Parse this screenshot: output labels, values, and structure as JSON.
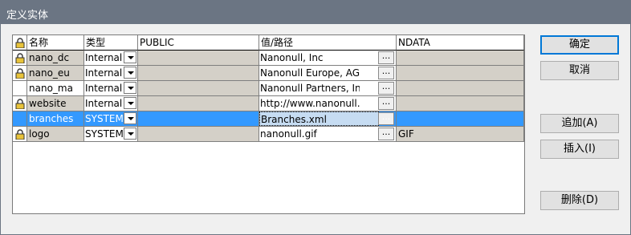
{
  "window": {
    "title": "定义实体"
  },
  "grid": {
    "headers": [
      "名称",
      "类型",
      "PUBLIC",
      "值/路径",
      "NDATA"
    ],
    "rows": [
      {
        "locked": true,
        "name": "nano_dc",
        "type": "Internal",
        "public": "",
        "value": "Nanonull, Inc",
        "ndata": "",
        "selected": false
      },
      {
        "locked": true,
        "name": "nano_eu",
        "type": "Internal",
        "public": "",
        "value": "Nanonull Europe, AG",
        "ndata": "",
        "selected": false
      },
      {
        "locked": false,
        "name": "nano_ma",
        "type": "Internal",
        "public": "",
        "value": "Nanonull Partners, Inc",
        "ndata": "",
        "selected": false
      },
      {
        "locked": true,
        "name": "website",
        "type": "Internal",
        "public": "",
        "value": "http://www.nanonull.com",
        "ndata": "",
        "selected": false
      },
      {
        "locked": false,
        "name": "branches",
        "type": "SYSTEM",
        "public": "",
        "value": "Branches.xml",
        "ndata": "",
        "selected": true
      },
      {
        "locked": true,
        "name": "logo",
        "type": "SYSTEM",
        "public": "",
        "value": "nanonull.gif",
        "ndata": "GIF",
        "selected": false
      }
    ],
    "browse_label": "..."
  },
  "buttons": {
    "ok": "确定",
    "cancel": "取消",
    "append": "追加(A)",
    "insert": "插入(I)",
    "delete": "删除(D)"
  }
}
